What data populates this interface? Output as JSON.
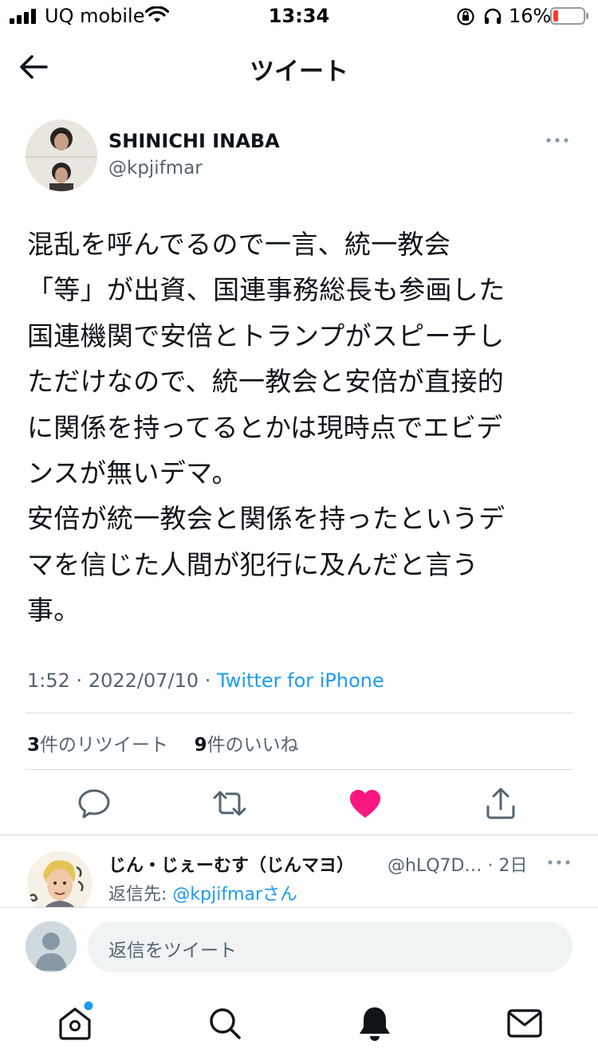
{
  "status_bar": {
    "carrier": "UQ mobile",
    "time": "13:34",
    "battery": "16%",
    "battery_color": "#ff3b30"
  },
  "nav": {
    "back_icon": "arrow-left-icon",
    "title": "ツイート"
  },
  "tweet": {
    "author_name": "SHINICHI INABA",
    "author_handle": "@kpjifmar",
    "text": "混乱を呼んでるので一言、統一教会\n「等」が出資、国連事務総長も参画した\n国連機関で安倍とトランプがスピーチし\nただけなので、統一教会と安倍が直接的\nに関係を持ってるとかは現時点でエビデ\nンスが無いデマ。\n安倍が統一教会と関係を持ったというデ\nマを信じた人間が犯行に及んだと言う\n事。",
    "time": "1:52",
    "date": "2022/07/10",
    "source": "Twitter for iPhone",
    "retweet_count": "3",
    "retweet_label": "件のリツイート",
    "like_count": "9",
    "like_label": "件のいいね"
  },
  "actions": [
    "reply-icon",
    "retweet-icon",
    "like-icon",
    "share-icon"
  ],
  "reply": {
    "name": "じん・じぇーむす（じんマヨ）",
    "handle": "@hLQ7D…",
    "age": "2日",
    "reply_to_prefix": "返信先: ",
    "reply_to_user": "@kpjifmarさん"
  },
  "composer": {
    "placeholder": "返信をツイート"
  },
  "tabbar": [
    "home-icon",
    "search-icon",
    "notifications-icon",
    "messages-icon"
  ],
  "colors": {
    "accent": "#1d9bf0",
    "like": "#f91880",
    "secondary_text": "#536471"
  }
}
